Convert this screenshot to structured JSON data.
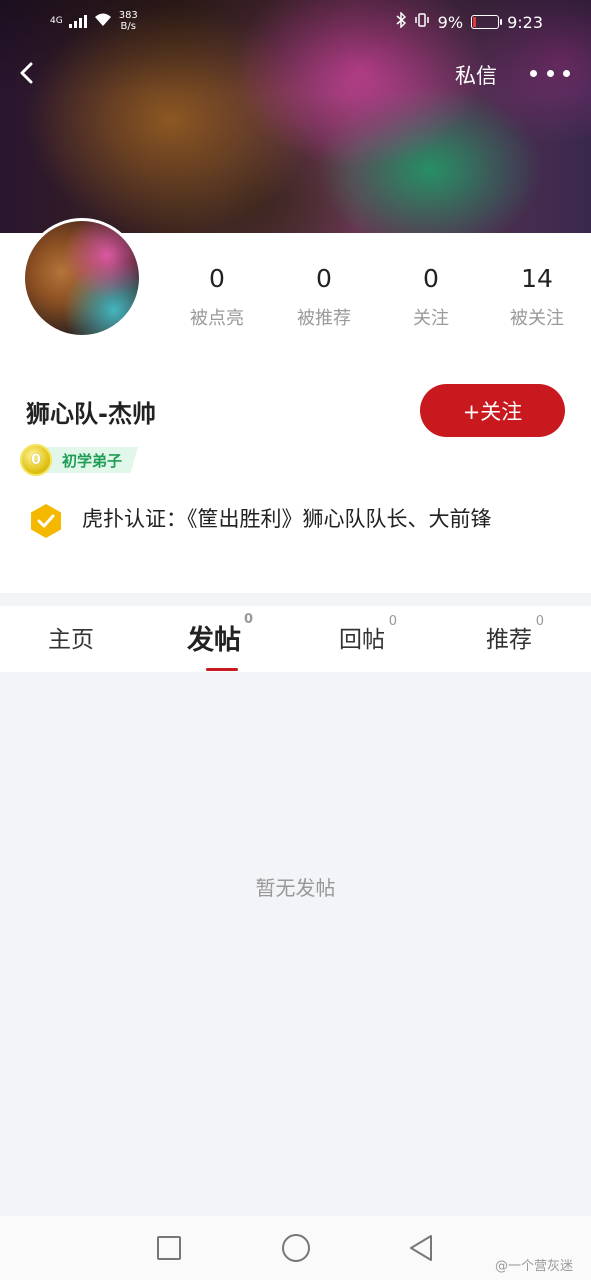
{
  "status_bar": {
    "signal": "4G",
    "net_speed_value": "383",
    "net_speed_unit": "B/s",
    "battery_percent": "9%",
    "time": "9:23"
  },
  "nav": {
    "private_message_label": "私信"
  },
  "profile": {
    "stats": [
      {
        "value": "0",
        "label": "被点亮"
      },
      {
        "value": "0",
        "label": "被推荐"
      },
      {
        "value": "0",
        "label": "关注"
      },
      {
        "value": "14",
        "label": "被关注"
      }
    ],
    "name": "狮心队-杰帅",
    "follow_label": "+关注",
    "level_coin": "0",
    "level_label": "初学弟子",
    "verification_text": "虎扑认证：《筐出胜利》狮心队队长、大前锋"
  },
  "tabs": [
    {
      "label": "主页",
      "count": ""
    },
    {
      "label": "发帖",
      "count": "0"
    },
    {
      "label": "回帖",
      "count": "0"
    },
    {
      "label": "推荐",
      "count": "0"
    }
  ],
  "content": {
    "empty_text": "暂无发帖"
  },
  "watermark": "@一个营灰迷",
  "colors": {
    "accent": "#c8191f",
    "level_green": "#1f9d55",
    "verify_yellow": "#f5b800"
  }
}
